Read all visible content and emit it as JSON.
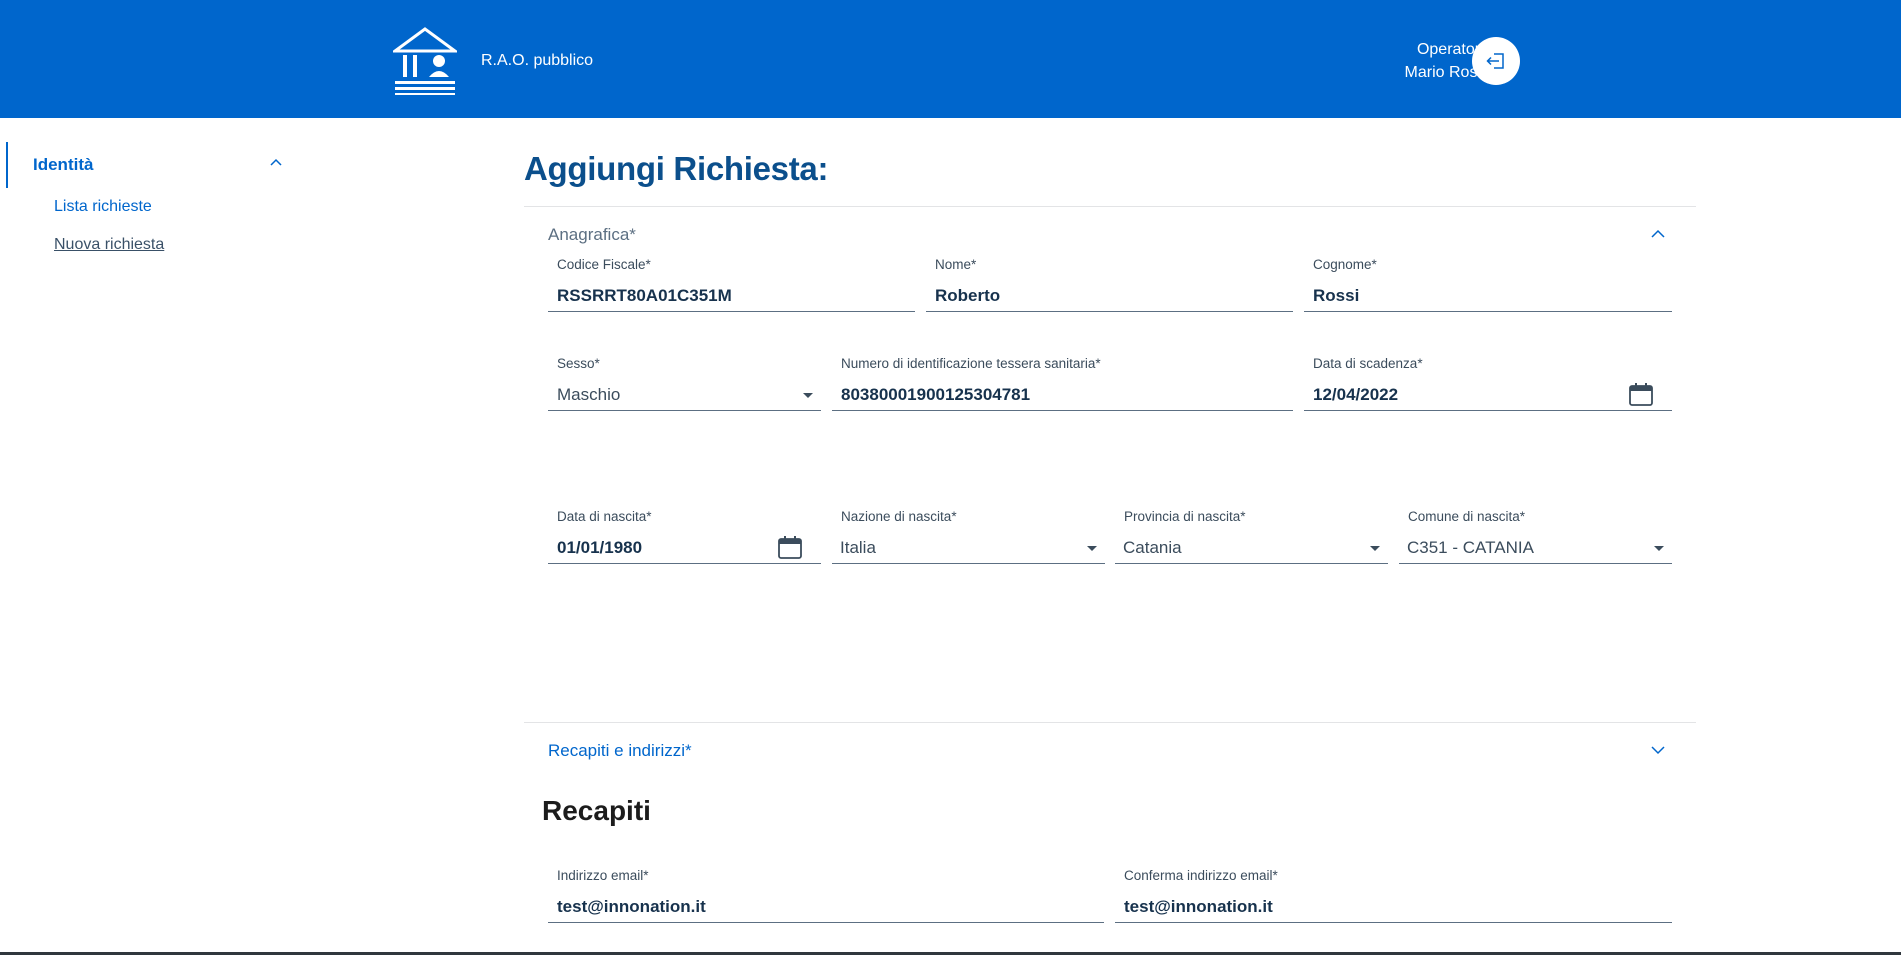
{
  "header": {
    "app_title": "R.A.O. pubblico",
    "user_role": "Operatore",
    "user_name": "Mario Rossi",
    "brand_color": "#0066cc"
  },
  "sidebar": {
    "section_label": "Identità",
    "items": [
      {
        "label": "Lista richieste"
      },
      {
        "label": "Nuova richiesta"
      }
    ]
  },
  "main": {
    "title": "Aggiungi Richiesta:",
    "anagrafica": {
      "label": "Anagrafica*",
      "codice_fiscale": {
        "label": "Codice Fiscale*",
        "value": "RSSRRT80A01C351M"
      },
      "nome": {
        "label": "Nome*",
        "value": "Roberto"
      },
      "cognome": {
        "label": "Cognome*",
        "value": "Rossi"
      },
      "sesso": {
        "label": "Sesso*",
        "value": "Maschio"
      },
      "tessera": {
        "label": "Numero di identificazione tessera sanitaria*",
        "value": "80380001900125304781"
      },
      "scadenza": {
        "label": "Data di scadenza*",
        "value": "12/04/2022"
      },
      "data_nascita": {
        "label": "Data di nascita*",
        "value": "01/01/1980"
      },
      "nazione": {
        "label": "Nazione di nascita*",
        "value": "Italia"
      },
      "provincia": {
        "label": "Provincia di nascita*",
        "value": "Catania"
      },
      "comune": {
        "label": "Comune di nascita*",
        "value": "C351 - CATANIA"
      }
    },
    "recapiti_section": {
      "label": "Recapiti e indirizzi*",
      "heading": "Recapiti",
      "email": {
        "label": "Indirizzo email*",
        "value": "test@innonation.it"
      },
      "email_confirm": {
        "label": "Conferma indirizzo email*",
        "value": "test@innonation.it"
      }
    }
  }
}
